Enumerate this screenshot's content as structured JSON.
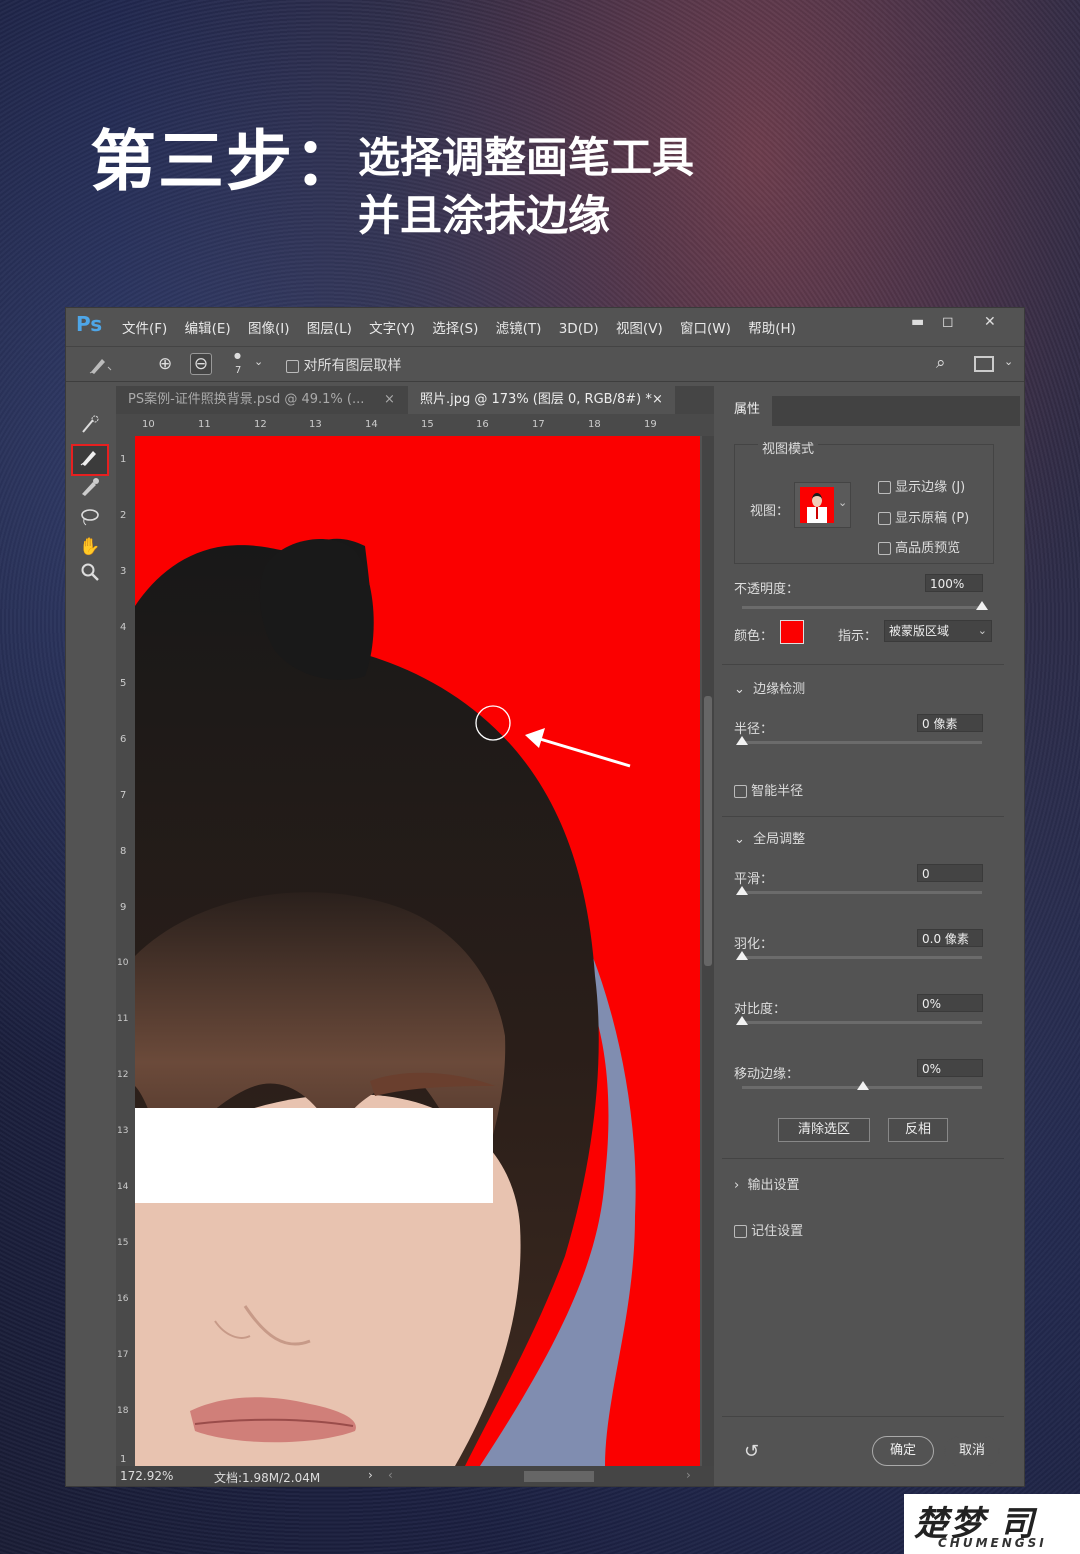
{
  "heading": {
    "main": "第三步：",
    "line1": "选择调整画笔工具",
    "line2": "并且涂抹边缘"
  },
  "app": {
    "logo": "Ps",
    "menu": [
      "文件(F)",
      "编辑(E)",
      "图像(I)",
      "图层(L)",
      "文字(Y)",
      "选择(S)",
      "滤镜(T)",
      "3D(D)",
      "视图(V)",
      "窗口(W)",
      "帮助(H)"
    ],
    "window_controls": {
      "minimize": "▬",
      "maximize": "◻",
      "close": "✕"
    },
    "options": {
      "brush_size": "7",
      "sample_all_layers": "对所有图层取样"
    },
    "tabs": [
      {
        "label": "PS案例-证件照换背景.psd @ 49.1% (...",
        "close": "×"
      },
      {
        "label": "照片.jpg @ 173% (图层 0, RGB/8#) *",
        "close": "×"
      }
    ],
    "ruler_h": [
      "10",
      "11",
      "12",
      "13",
      "14",
      "15",
      "16",
      "17",
      "18",
      "19"
    ],
    "ruler_v": [
      "1",
      "2",
      "3",
      "4",
      "5",
      "6",
      "7",
      "8",
      "9",
      "10",
      "11",
      "12",
      "13",
      "14",
      "15",
      "16",
      "17",
      "18",
      "1"
    ],
    "status": {
      "zoom": "172.92%",
      "doc": "文档:1.98M/2.04M"
    }
  },
  "panel": {
    "tab": "属性",
    "view_mode": {
      "title": "视图模式",
      "view_label": "视图：",
      "show_edge": "显示边缘 (J)",
      "show_original": "显示原稿 (P)",
      "hq_preview": "高品质预览"
    },
    "opacity": {
      "label": "不透明度：",
      "value": "100%"
    },
    "color": {
      "label": "颜色：",
      "swatch": "#fb0000"
    },
    "indicate": {
      "label": "指示：",
      "value": "被蒙版区域"
    },
    "edge_detection": {
      "title": "边缘检测",
      "radius_label": "半径：",
      "radius_value": "0 像素",
      "smart_radius": "智能半径"
    },
    "global_refine": {
      "title": "全局调整",
      "smooth_label": "平滑：",
      "smooth_value": "0",
      "feather_label": "羽化：",
      "feather_value": "0.0 像素",
      "contrast_label": "对比度：",
      "contrast_value": "0%",
      "shift_label": "移动边缘：",
      "shift_value": "0%"
    },
    "clear_selection": "清除选区",
    "invert": "反相",
    "output": {
      "title": "输出设置"
    },
    "remember": "记住设置",
    "ok": "确定",
    "cancel": "取消"
  },
  "watermark": {
    "brand": "楚梦 司",
    "sub": "CHUMENGSI"
  }
}
